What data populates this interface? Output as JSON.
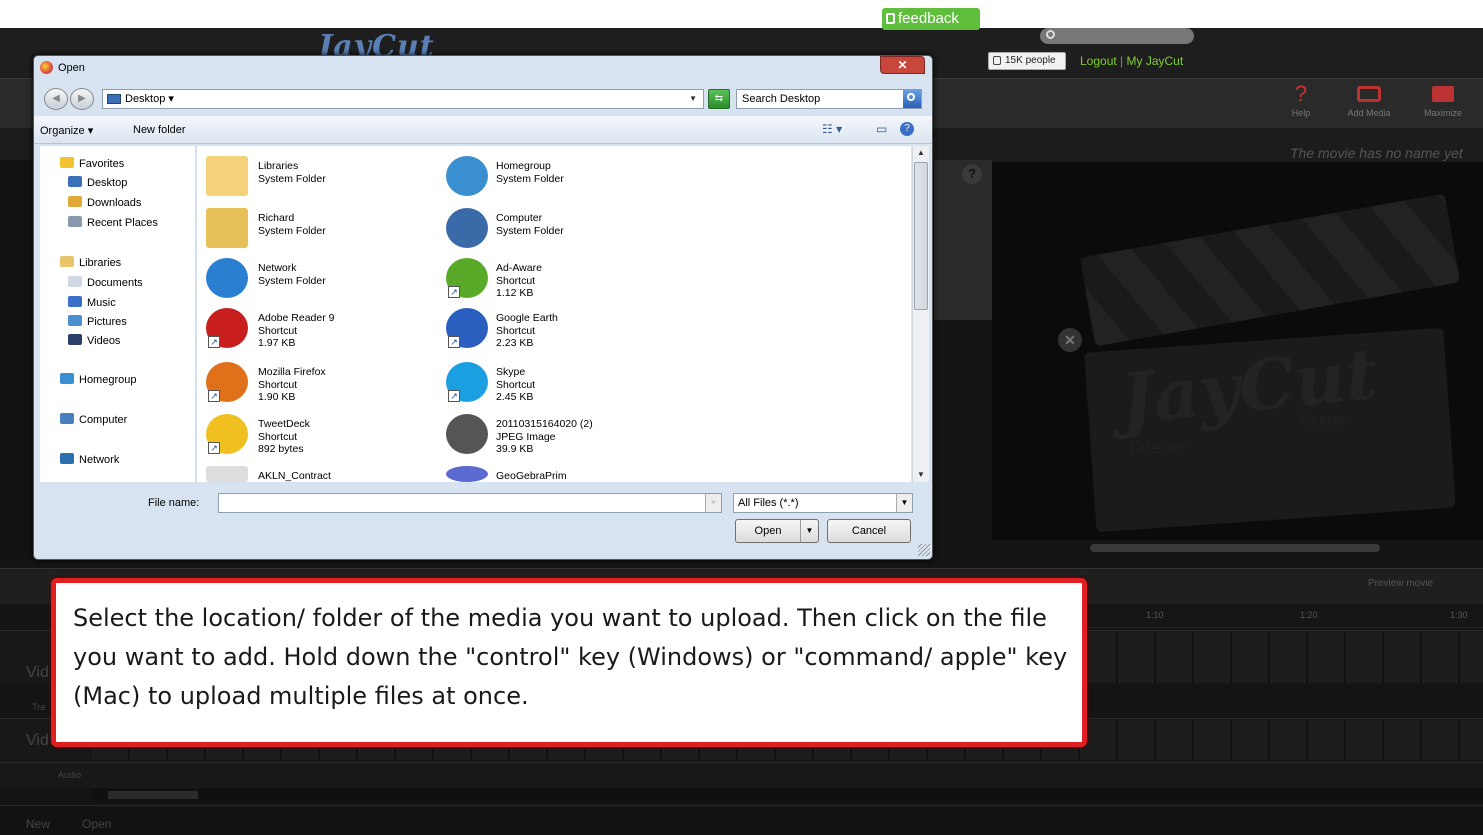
{
  "app": {
    "brand": "JayCut",
    "feedback_label": "feedback",
    "like_count": "15K people",
    "logout_label": "Logout",
    "separator": "|",
    "my_account_label": "My JayCut",
    "accent_green": "#7fd12f",
    "accent_red": "#e02020"
  },
  "toolbar": {
    "help": "Help",
    "add_media": "Add Media",
    "maximize": "Maximize"
  },
  "movie": {
    "name_placeholder": "The movie has no name yet",
    "clapper_director": "Director:",
    "clapper_scene": "Scene:",
    "preview_label": "Preview movie"
  },
  "timeline": {
    "ticks": [
      "1:10",
      "1:20",
      "1:30"
    ],
    "tracks": [
      {
        "label": "Vid",
        "sub": "Tra"
      },
      {
        "label": "Vid",
        "sub": "Audio"
      }
    ]
  },
  "footer": {
    "new_label": "New",
    "open_label": "Open"
  },
  "dialog": {
    "title": "Open",
    "location": "Desktop",
    "search_placeholder": "Search Desktop",
    "organize_label": "Organize ▾",
    "new_folder_label": "New folder",
    "nav": [
      {
        "label": "Favorites",
        "icon": "star-icon",
        "color": "#f2c230"
      },
      {
        "label": "Desktop",
        "icon": "desktop-icon",
        "color": "#3b6fb8"
      },
      {
        "label": "Downloads",
        "icon": "downloads-icon",
        "color": "#e0a93a"
      },
      {
        "label": "Recent Places",
        "icon": "recent-places-icon",
        "color": "#8a9aae"
      },
      {
        "label": "Libraries",
        "icon": "libraries-icon",
        "color": "#e8c56a"
      },
      {
        "label": "Documents",
        "icon": "documents-icon",
        "color": "#cfd8e4"
      },
      {
        "label": "Music",
        "icon": "music-icon",
        "color": "#3a6fc8"
      },
      {
        "label": "Pictures",
        "icon": "pictures-icon",
        "color": "#4a8fd0"
      },
      {
        "label": "Videos",
        "icon": "videos-icon",
        "color": "#2a3f6a"
      },
      {
        "label": "Homegroup",
        "icon": "homegroup-icon",
        "color": "#3a8fd0"
      },
      {
        "label": "Computer",
        "icon": "computer-icon",
        "color": "#4a7fbf"
      },
      {
        "label": "Network",
        "icon": "network-icon",
        "color": "#2a6fb0"
      }
    ],
    "files": [
      {
        "name": "Libraries",
        "type": "System Folder",
        "size": "",
        "icon": "libraries-folder-icon",
        "color": "#f3d27a"
      },
      {
        "name": "Homegroup",
        "type": "System Folder",
        "size": "",
        "icon": "homegroup-icon",
        "color": "#3a8fd0"
      },
      {
        "name": "Richard",
        "type": "System Folder",
        "size": "",
        "icon": "user-folder-icon",
        "color": "#e8c05a"
      },
      {
        "name": "Computer",
        "type": "System Folder",
        "size": "",
        "icon": "computer-icon",
        "color": "#3a6aa8"
      },
      {
        "name": "Network",
        "type": "System Folder",
        "size": "",
        "icon": "network-globe-icon",
        "color": "#2a7fd0"
      },
      {
        "name": "Ad-Aware",
        "type": "Shortcut",
        "size": "1.12 KB",
        "icon": "ad-aware-icon",
        "color": "#5aaa2a"
      },
      {
        "name": "Adobe Reader 9",
        "type": "Shortcut",
        "size": "1.97 KB",
        "icon": "adobe-reader-icon",
        "color": "#c81e1e"
      },
      {
        "name": "Google Earth",
        "type": "Shortcut",
        "size": "2.23 KB",
        "icon": "google-earth-icon",
        "color": "#2a5fbf"
      },
      {
        "name": "Mozilla Firefox",
        "type": "Shortcut",
        "size": "1.90 KB",
        "icon": "firefox-icon",
        "color": "#e0701a"
      },
      {
        "name": "Skype",
        "type": "Shortcut",
        "size": "2.45 KB",
        "icon": "skype-icon",
        "color": "#1aa0e0"
      },
      {
        "name": "TweetDeck",
        "type": "Shortcut",
        "size": "892 bytes",
        "icon": "tweetdeck-icon",
        "color": "#f0c020"
      },
      {
        "name": "20110315164020 (2)",
        "type": "JPEG Image",
        "size": "39.9 KB",
        "icon": "image-thumbnail-icon",
        "color": "#555555"
      },
      {
        "name": "AKLN_Contract",
        "type": "",
        "size": "",
        "icon": "document-icon",
        "color": "#dddddd"
      },
      {
        "name": "GeoGebraPrim",
        "type": "",
        "size": "",
        "icon": "geogebra-icon",
        "color": "#5a6ad0"
      }
    ],
    "filename_label": "File name:",
    "filename_value": "",
    "filetype": "All Files (*.*)",
    "open_label": "Open",
    "cancel_label": "Cancel"
  },
  "callout": {
    "text": "Select the location/ folder of the media you want to upload. Then click on the file you want to add. Hold down the \"control\" key (Windows) or \"command/ apple\" key (Mac) to upload multiple files at once."
  }
}
